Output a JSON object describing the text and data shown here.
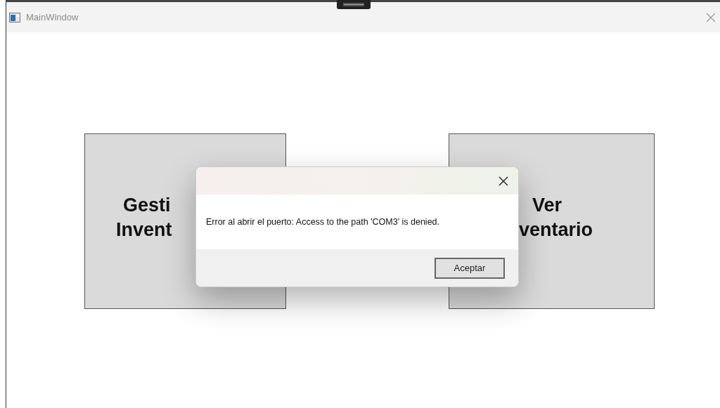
{
  "window": {
    "title": "MainWindow"
  },
  "tiles": [
    {
      "lines": [
        "Gesti",
        "Invent"
      ]
    },
    {
      "lines": [
        "Ver",
        "ventario"
      ]
    }
  ],
  "dialog": {
    "message": "Error al abrir el puerto: Access to the path 'COM3' is denied.",
    "buttons": [
      "Aceptar"
    ]
  }
}
